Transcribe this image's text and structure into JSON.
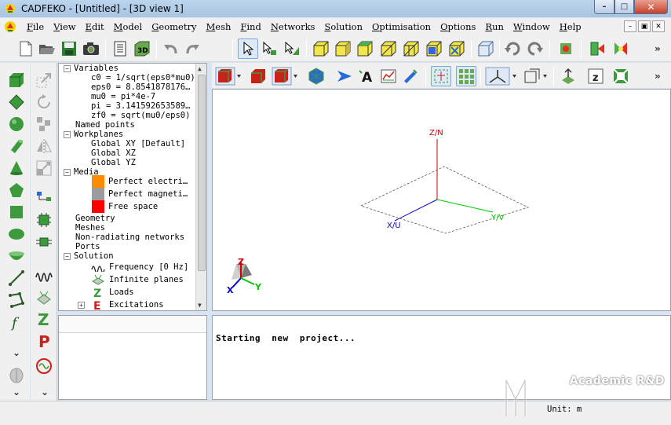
{
  "window": {
    "title": "CADFEKO - [Untitled] - [3D view 1]"
  },
  "menubar": {
    "items": [
      "File",
      "View",
      "Edit",
      "Model",
      "Geometry",
      "Mesh",
      "Find",
      "Networks",
      "Solution",
      "Optimisation",
      "Options",
      "Run",
      "Window",
      "Help"
    ]
  },
  "tree": {
    "variables_label": "Variables",
    "variables": [
      "c0 = 1/sqrt(eps0*mu0)",
      "eps0 = 8.8541878176…",
      "mu0 = pi*4e-7",
      "pi = 3.141592653589…",
      "zf0 = sqrt(mu0/eps0)"
    ],
    "named_points": "Named points",
    "workplanes_label": "Workplanes",
    "workplanes": [
      "Global XY [Default]",
      "Global XZ",
      "Global YZ"
    ],
    "media_label": "Media",
    "media": [
      {
        "label": "Perfect electri…",
        "color": "#ff8c00"
      },
      {
        "label": "Perfect magneti…",
        "color": "#9c9c9c"
      },
      {
        "label": "Free space",
        "color": "#ff0000"
      }
    ],
    "geometry": "Geometry",
    "meshes": "Meshes",
    "non_radiating": "Non-radiating networks",
    "ports": "Ports",
    "solution_label": "Solution",
    "solution_items": [
      "Frequency [0 Hz]",
      "Infinite planes",
      "Loads",
      "Excitations"
    ]
  },
  "view": {
    "axis_z": "Z/N",
    "axis_x": "X/U",
    "axis_y": "Y/V",
    "triad_z": "Z",
    "triad_x": "X",
    "triad_y": "Y",
    "colors": {
      "x": "#0000c8",
      "y": "#00c800",
      "z": "#c80000"
    }
  },
  "message": {
    "text": "Starting  new  project..."
  },
  "status": {
    "units": "Unit: m"
  },
  "watermark": {
    "text": "Academic R&D"
  }
}
